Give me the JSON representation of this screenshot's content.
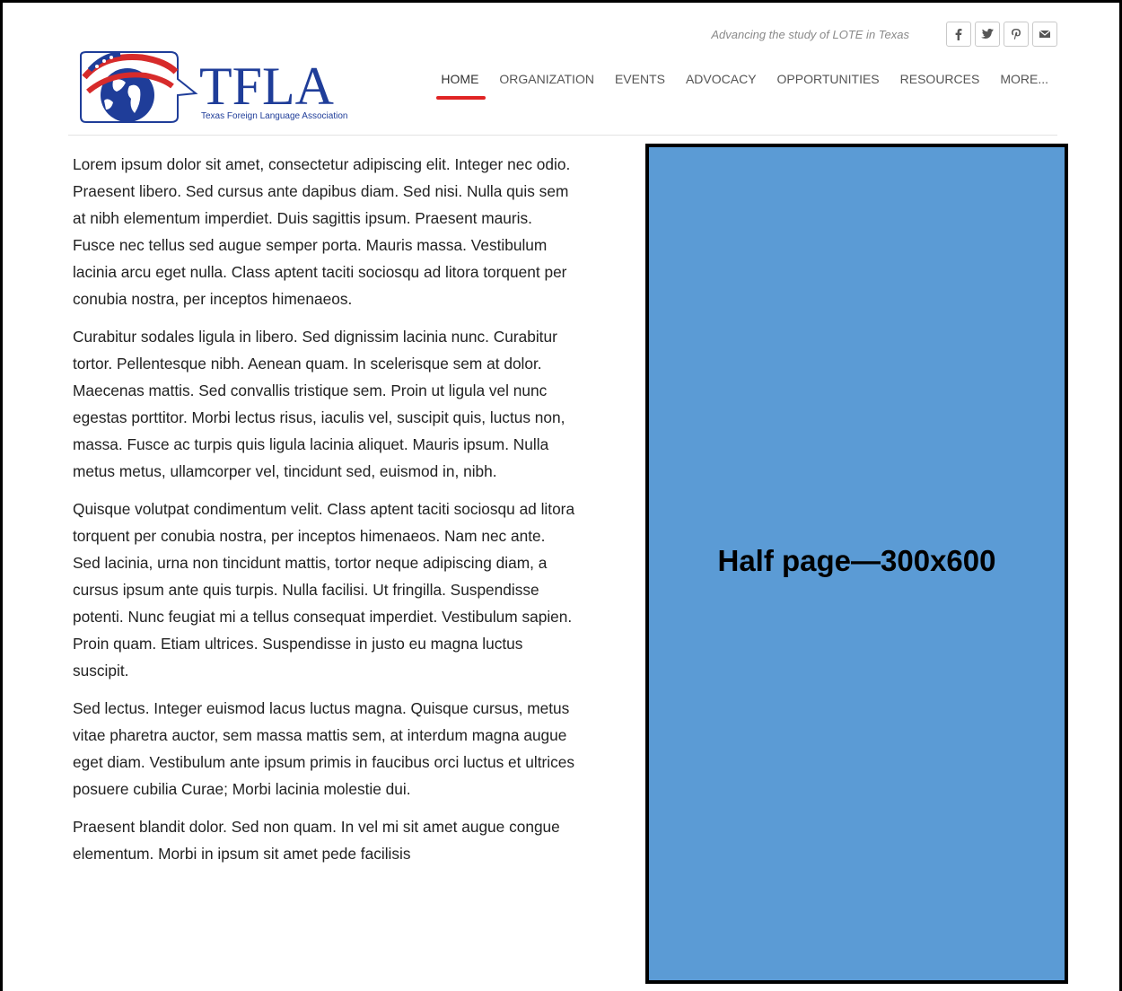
{
  "header": {
    "logo": {
      "title": "TFLA",
      "subtitle": "Texas Foreign Language Association"
    },
    "tagline": "Advancing the study of LOTE in Texas",
    "social": [
      {
        "icon": "facebook-icon",
        "glyph": "f"
      },
      {
        "icon": "twitter-icon",
        "glyph": "t"
      },
      {
        "icon": "pinterest-icon",
        "glyph": "p"
      },
      {
        "icon": "mail-icon",
        "glyph": "m"
      }
    ],
    "nav": [
      {
        "label": "HOME",
        "active": true
      },
      {
        "label": "ORGANIZATION",
        "active": false
      },
      {
        "label": "EVENTS",
        "active": false
      },
      {
        "label": "ADVOCACY",
        "active": false
      },
      {
        "label": "OPPORTUNITIES",
        "active": false
      },
      {
        "label": "RESOURCES",
        "active": false
      },
      {
        "label": "MORE...",
        "active": false
      }
    ]
  },
  "content": {
    "paragraphs": [
      "Lorem ipsum dolor sit amet, consectetur adipiscing elit. Integer nec odio. Praesent libero. Sed cursus ante dapibus diam. Sed nisi. Nulla quis sem at nibh elementum imperdiet. Duis sagittis ipsum. Praesent mauris. Fusce nec tellus sed augue semper porta. Mauris massa. Vestibulum lacinia arcu eget nulla. Class aptent taciti sociosqu ad litora torquent per conubia nostra, per inceptos himenaeos.",
      "Curabitur sodales ligula in libero. Sed dignissim lacinia nunc. Curabitur tortor. Pellentesque nibh. Aenean quam. In scelerisque sem at dolor. Maecenas mattis. Sed convallis tristique sem. Proin ut ligula vel nunc egestas porttitor. Morbi lectus risus, iaculis vel, suscipit quis, luctus non, massa. Fusce ac turpis quis ligula lacinia aliquet. Mauris ipsum. Nulla metus metus, ullamcorper vel, tincidunt sed, euismod in, nibh.",
      "Quisque volutpat condimentum velit. Class aptent taciti sociosqu ad litora torquent per conubia nostra, per inceptos himenaeos. Nam nec ante. Sed lacinia, urna non tincidunt mattis, tortor neque adipiscing diam, a cursus ipsum ante quis turpis. Nulla facilisi. Ut fringilla. Suspendisse potenti. Nunc feugiat mi a tellus consequat imperdiet. Vestibulum sapien. Proin quam. Etiam ultrices. Suspendisse in justo eu magna luctus suscipit.",
      "Sed lectus. Integer euismod lacus luctus magna. Quisque cursus, metus vitae pharetra auctor, sem massa mattis sem, at interdum magna augue eget diam. Vestibulum ante ipsum primis in faucibus orci luctus et ultrices posuere cubilia Curae; Morbi lacinia molestie dui.",
      "Praesent blandit dolor. Sed non quam. In vel mi sit amet augue congue elementum. Morbi in ipsum sit amet pede facilisis"
    ]
  },
  "ad": {
    "label": "Half page—300x600",
    "background": "#5b9bd5"
  },
  "colors": {
    "brand_blue": "#1f3d99",
    "accent_red": "#e02424",
    "nav_text": "#555555"
  }
}
